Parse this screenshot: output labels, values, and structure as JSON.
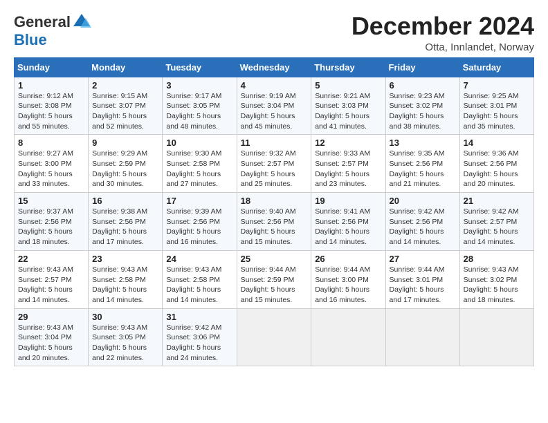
{
  "logo": {
    "text_general": "General",
    "text_blue": "Blue"
  },
  "header": {
    "month_year": "December 2024",
    "location": "Otta, Innlandet, Norway"
  },
  "weekdays": [
    "Sunday",
    "Monday",
    "Tuesday",
    "Wednesday",
    "Thursday",
    "Friday",
    "Saturday"
  ],
  "weeks": [
    [
      {
        "day": "1",
        "info": "Sunrise: 9:12 AM\nSunset: 3:08 PM\nDaylight: 5 hours\nand 55 minutes."
      },
      {
        "day": "2",
        "info": "Sunrise: 9:15 AM\nSunset: 3:07 PM\nDaylight: 5 hours\nand 52 minutes."
      },
      {
        "day": "3",
        "info": "Sunrise: 9:17 AM\nSunset: 3:05 PM\nDaylight: 5 hours\nand 48 minutes."
      },
      {
        "day": "4",
        "info": "Sunrise: 9:19 AM\nSunset: 3:04 PM\nDaylight: 5 hours\nand 45 minutes."
      },
      {
        "day": "5",
        "info": "Sunrise: 9:21 AM\nSunset: 3:03 PM\nDaylight: 5 hours\nand 41 minutes."
      },
      {
        "day": "6",
        "info": "Sunrise: 9:23 AM\nSunset: 3:02 PM\nDaylight: 5 hours\nand 38 minutes."
      },
      {
        "day": "7",
        "info": "Sunrise: 9:25 AM\nSunset: 3:01 PM\nDaylight: 5 hours\nand 35 minutes."
      }
    ],
    [
      {
        "day": "8",
        "info": "Sunrise: 9:27 AM\nSunset: 3:00 PM\nDaylight: 5 hours\nand 33 minutes."
      },
      {
        "day": "9",
        "info": "Sunrise: 9:29 AM\nSunset: 2:59 PM\nDaylight: 5 hours\nand 30 minutes."
      },
      {
        "day": "10",
        "info": "Sunrise: 9:30 AM\nSunset: 2:58 PM\nDaylight: 5 hours\nand 27 minutes."
      },
      {
        "day": "11",
        "info": "Sunrise: 9:32 AM\nSunset: 2:57 PM\nDaylight: 5 hours\nand 25 minutes."
      },
      {
        "day": "12",
        "info": "Sunrise: 9:33 AM\nSunset: 2:57 PM\nDaylight: 5 hours\nand 23 minutes."
      },
      {
        "day": "13",
        "info": "Sunrise: 9:35 AM\nSunset: 2:56 PM\nDaylight: 5 hours\nand 21 minutes."
      },
      {
        "day": "14",
        "info": "Sunrise: 9:36 AM\nSunset: 2:56 PM\nDaylight: 5 hours\nand 20 minutes."
      }
    ],
    [
      {
        "day": "15",
        "info": "Sunrise: 9:37 AM\nSunset: 2:56 PM\nDaylight: 5 hours\nand 18 minutes."
      },
      {
        "day": "16",
        "info": "Sunrise: 9:38 AM\nSunset: 2:56 PM\nDaylight: 5 hours\nand 17 minutes."
      },
      {
        "day": "17",
        "info": "Sunrise: 9:39 AM\nSunset: 2:56 PM\nDaylight: 5 hours\nand 16 minutes."
      },
      {
        "day": "18",
        "info": "Sunrise: 9:40 AM\nSunset: 2:56 PM\nDaylight: 5 hours\nand 15 minutes."
      },
      {
        "day": "19",
        "info": "Sunrise: 9:41 AM\nSunset: 2:56 PM\nDaylight: 5 hours\nand 14 minutes."
      },
      {
        "day": "20",
        "info": "Sunrise: 9:42 AM\nSunset: 2:56 PM\nDaylight: 5 hours\nand 14 minutes."
      },
      {
        "day": "21",
        "info": "Sunrise: 9:42 AM\nSunset: 2:57 PM\nDaylight: 5 hours\nand 14 minutes."
      }
    ],
    [
      {
        "day": "22",
        "info": "Sunrise: 9:43 AM\nSunset: 2:57 PM\nDaylight: 5 hours\nand 14 minutes."
      },
      {
        "day": "23",
        "info": "Sunrise: 9:43 AM\nSunset: 2:58 PM\nDaylight: 5 hours\nand 14 minutes."
      },
      {
        "day": "24",
        "info": "Sunrise: 9:43 AM\nSunset: 2:58 PM\nDaylight: 5 hours\nand 14 minutes."
      },
      {
        "day": "25",
        "info": "Sunrise: 9:44 AM\nSunset: 2:59 PM\nDaylight: 5 hours\nand 15 minutes."
      },
      {
        "day": "26",
        "info": "Sunrise: 9:44 AM\nSunset: 3:00 PM\nDaylight: 5 hours\nand 16 minutes."
      },
      {
        "day": "27",
        "info": "Sunrise: 9:44 AM\nSunset: 3:01 PM\nDaylight: 5 hours\nand 17 minutes."
      },
      {
        "day": "28",
        "info": "Sunrise: 9:43 AM\nSunset: 3:02 PM\nDaylight: 5 hours\nand 18 minutes."
      }
    ],
    [
      {
        "day": "29",
        "info": "Sunrise: 9:43 AM\nSunset: 3:04 PM\nDaylight: 5 hours\nand 20 minutes."
      },
      {
        "day": "30",
        "info": "Sunrise: 9:43 AM\nSunset: 3:05 PM\nDaylight: 5 hours\nand 22 minutes."
      },
      {
        "day": "31",
        "info": "Sunrise: 9:42 AM\nSunset: 3:06 PM\nDaylight: 5 hours\nand 24 minutes."
      },
      {
        "day": "",
        "info": ""
      },
      {
        "day": "",
        "info": ""
      },
      {
        "day": "",
        "info": ""
      },
      {
        "day": "",
        "info": ""
      }
    ]
  ]
}
